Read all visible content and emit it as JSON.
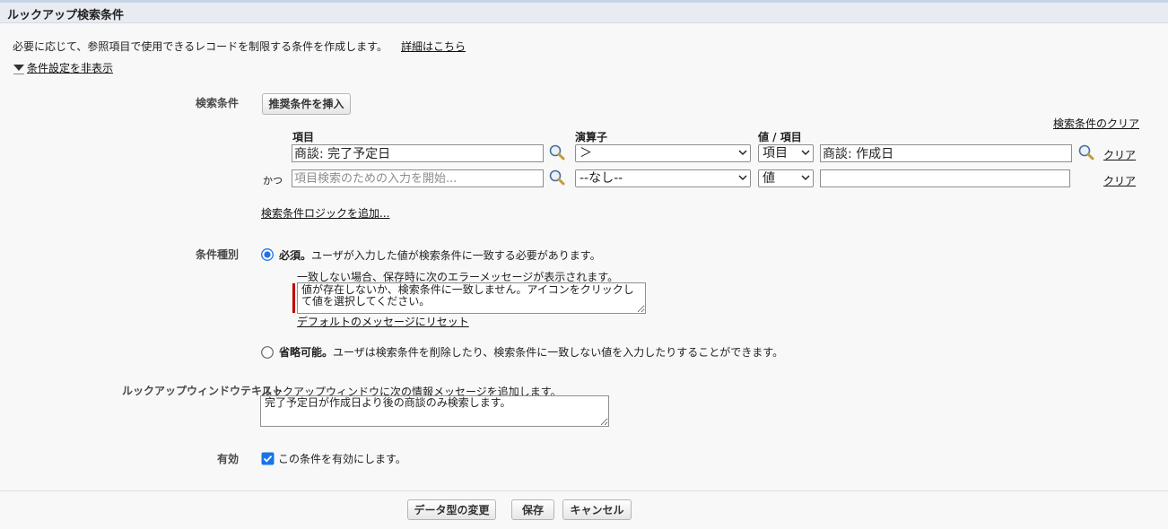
{
  "header": {
    "title": "ルックアップ検索条件"
  },
  "intro": {
    "text": "必要に応じて、参照項目で使用できるレコードを制限する条件を作成します。",
    "help_link": "詳細はこちら"
  },
  "toggle": {
    "label": "条件設定を非表示"
  },
  "criteria": {
    "label": "検索条件",
    "insert_button": "推奨条件を挿入",
    "clear_all_link": "検索条件のクリア",
    "columns": {
      "field": "項目",
      "operator": "演算子",
      "value": "値 / 項目"
    },
    "rows": [
      {
        "prefix": "",
        "field_value": "商談: 完了予定日",
        "field_placeholder": "",
        "operator": "＞",
        "value_type": "項目",
        "value": "商談: 作成日",
        "clear": "クリア"
      },
      {
        "prefix": "かつ",
        "field_value": "",
        "field_placeholder": "項目検索のための入力を開始...",
        "operator": "--なし--",
        "value_type": "値",
        "value": "",
        "clear": "クリア"
      }
    ],
    "add_logic_link": "検索条件ロジックを追加..."
  },
  "filter_type": {
    "label": "条件種別",
    "required": {
      "bold": "必須。",
      "text": "ユーザが入力した値が検索条件に一致する必要があります。",
      "selected": true,
      "error_caption": "一致しない場合、保存時に次のエラーメッセージが表示されます。",
      "error_message": "値が存在しないか、検索条件に一致しません。アイコンをクリックして値を選択してください。",
      "reset_link": "デフォルトのメッセージにリセット"
    },
    "optional": {
      "bold": "省略可能。",
      "text": "ユーザは検索条件を削除したり、検索条件に一致しない値を入力したりすることができます。",
      "selected": false
    }
  },
  "lookup_window": {
    "label": "ルックアップウィンドウテキスト",
    "caption": "ルックアップウィンドウに次の情報メッセージを追加します。",
    "message": "完了予定日が作成日より後の商談のみ検索します。"
  },
  "active": {
    "label": "有効",
    "checkbox_label": "この条件を有効にします。",
    "checked": true
  },
  "footer": {
    "change_type": "データ型の変更",
    "save": "保存",
    "cancel": "キャンセル"
  },
  "colors": {
    "header_bg": "#e9ebf2",
    "radio_accent": "#1a73e8",
    "checkbox_accent": "#1a73e8",
    "error_bar": "#c00000"
  },
  "icons": {
    "lookup": "magnifier-icon",
    "toggle": "triangle-down-icon",
    "dropdown": "chevron-down-icon"
  }
}
